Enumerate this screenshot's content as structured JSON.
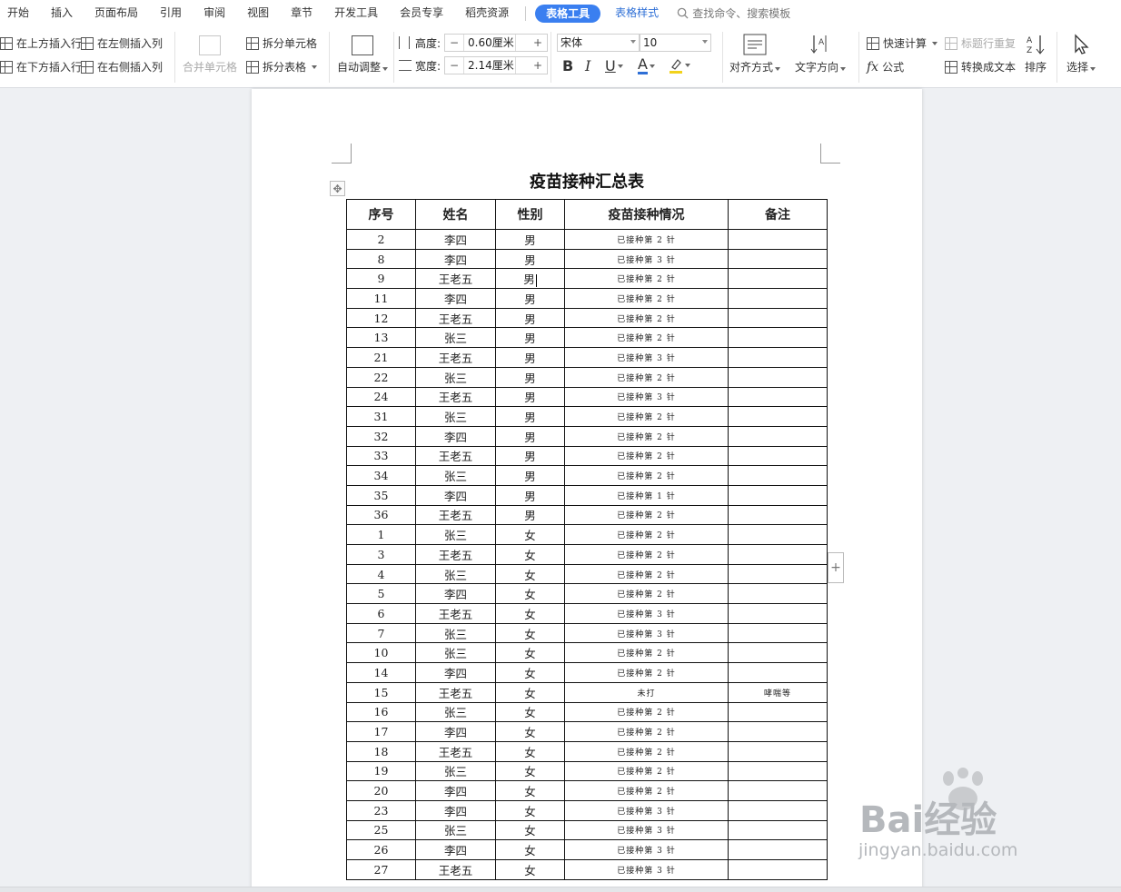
{
  "menubar": {
    "items": [
      "开始",
      "插入",
      "页面布局",
      "引用",
      "审阅",
      "视图",
      "章节",
      "开发工具",
      "会员专享",
      "稻壳资源"
    ],
    "active_tab": "表格工具",
    "style_tab": "表格样式",
    "search_placeholder": "查找命令、搜索模板"
  },
  "toolbar": {
    "insert_above": "在上方插入行",
    "insert_below": "在下方插入行",
    "insert_left": "在左侧插入列",
    "insert_right": "在右侧插入列",
    "merge_cells": "合并单元格",
    "split_cells": "拆分单元格",
    "split_table": "拆分表格",
    "auto_adjust": "自动调整",
    "height_label": "高度:",
    "height_value": "0.60厘米",
    "width_label": "宽度:",
    "width_value": "2.14厘米",
    "font_name": "宋体",
    "font_size": "10",
    "align": "对齐方式",
    "text_direction": "文字方向",
    "quick_calc": "快速计算",
    "repeat_header": "标题行重复",
    "formula": "公式",
    "to_text": "转换成文本",
    "sort": "排序",
    "select": "选择",
    "minus": "−",
    "plus": "+"
  },
  "document": {
    "title": "疫苗接种汇总表",
    "headers": [
      "序号",
      "姓名",
      "性别",
      "疫苗接种情况",
      "备注"
    ],
    "rows": [
      [
        "2",
        "李四",
        "男",
        "已接种第 2 针",
        ""
      ],
      [
        "8",
        "李四",
        "男",
        "已接种第 3 针",
        ""
      ],
      [
        "9",
        "王老五",
        "男",
        "已接种第 2 针",
        ""
      ],
      [
        "11",
        "李四",
        "男",
        "已接种第 2 针",
        ""
      ],
      [
        "12",
        "王老五",
        "男",
        "已接种第 2 针",
        ""
      ],
      [
        "13",
        "张三",
        "男",
        "已接种第 2 针",
        ""
      ],
      [
        "21",
        "王老五",
        "男",
        "已接种第 3 针",
        ""
      ],
      [
        "22",
        "张三",
        "男",
        "已接种第 2 针",
        ""
      ],
      [
        "24",
        "王老五",
        "男",
        "已接种第 3 针",
        ""
      ],
      [
        "31",
        "张三",
        "男",
        "已接种第 2 针",
        ""
      ],
      [
        "32",
        "李四",
        "男",
        "已接种第 2 针",
        ""
      ],
      [
        "33",
        "王老五",
        "男",
        "已接种第 2 针",
        ""
      ],
      [
        "34",
        "张三",
        "男",
        "已接种第 2 针",
        ""
      ],
      [
        "35",
        "李四",
        "男",
        "已接种第 1 针",
        ""
      ],
      [
        "36",
        "王老五",
        "男",
        "已接种第 2 针",
        ""
      ],
      [
        "1",
        "张三",
        "女",
        "已接种第 2 针",
        ""
      ],
      [
        "3",
        "王老五",
        "女",
        "已接种第 2 针",
        ""
      ],
      [
        "4",
        "张三",
        "女",
        "已接种第 2 针",
        ""
      ],
      [
        "5",
        "李四",
        "女",
        "已接种第 2 针",
        ""
      ],
      [
        "6",
        "王老五",
        "女",
        "已接种第 3 针",
        ""
      ],
      [
        "7",
        "张三",
        "女",
        "已接种第 3 针",
        ""
      ],
      [
        "10",
        "张三",
        "女",
        "已接种第 2 针",
        ""
      ],
      [
        "14",
        "李四",
        "女",
        "已接种第 2 针",
        ""
      ],
      [
        "15",
        "王老五",
        "女",
        "未打",
        "哮喘等"
      ],
      [
        "16",
        "张三",
        "女",
        "已接种第 2 针",
        ""
      ],
      [
        "17",
        "李四",
        "女",
        "已接种第 2 针",
        ""
      ],
      [
        "18",
        "王老五",
        "女",
        "已接种第 2 针",
        ""
      ],
      [
        "19",
        "张三",
        "女",
        "已接种第 2 针",
        ""
      ],
      [
        "20",
        "李四",
        "女",
        "已接种第 2 针",
        ""
      ],
      [
        "23",
        "李四",
        "女",
        "已接种第 3 针",
        ""
      ],
      [
        "25",
        "张三",
        "女",
        "已接种第 3 针",
        ""
      ],
      [
        "26",
        "李四",
        "女",
        "已接种第 3 针",
        ""
      ],
      [
        "27",
        "王老五",
        "女",
        "已接种第 3 针",
        ""
      ]
    ]
  },
  "watermark": {
    "brand": "Bai经验",
    "url": "jingyan.baidu.com"
  },
  "colors": {
    "accent": "#3a7ff0",
    "page": "#ffffff",
    "workspace": "#eef0f3"
  }
}
